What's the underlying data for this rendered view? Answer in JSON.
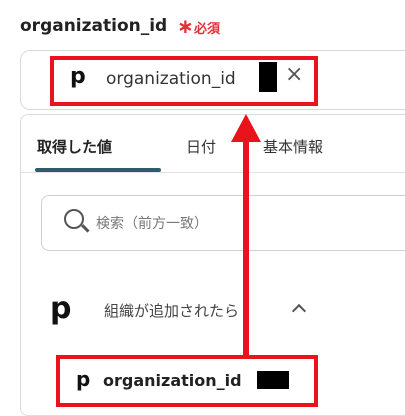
{
  "field": {
    "label": "organization_id",
    "required_star": "∗",
    "required_text": "必須",
    "chip_icon": "p",
    "chip_text": "organization_id",
    "clear_icon": "×"
  },
  "tabs": [
    {
      "label": "取得した値",
      "active": true
    },
    {
      "label": "日付",
      "active": false
    },
    {
      "label": "基本情報",
      "active": false
    }
  ],
  "search": {
    "placeholder": "検索（前方一致）"
  },
  "group": {
    "icon": "p",
    "label": "組織が追加されたら"
  },
  "item": {
    "icon": "p",
    "label": "organization_id"
  },
  "colors": {
    "highlight": "#e8131d",
    "required": "#e0323a",
    "tab_accent": "#2f5b6f"
  }
}
